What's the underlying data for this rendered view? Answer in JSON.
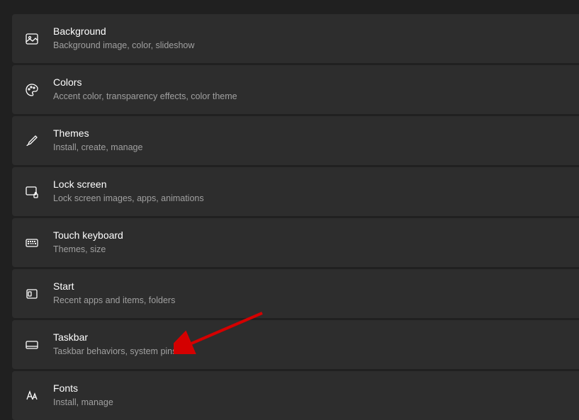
{
  "items": [
    {
      "title": "Background",
      "subtitle": "Background image, color, slideshow"
    },
    {
      "title": "Colors",
      "subtitle": "Accent color, transparency effects, color theme"
    },
    {
      "title": "Themes",
      "subtitle": "Install, create, manage"
    },
    {
      "title": "Lock screen",
      "subtitle": "Lock screen images, apps, animations"
    },
    {
      "title": "Touch keyboard",
      "subtitle": "Themes, size"
    },
    {
      "title": "Start",
      "subtitle": "Recent apps and items, folders"
    },
    {
      "title": "Taskbar",
      "subtitle": "Taskbar behaviors, system pins"
    },
    {
      "title": "Fonts",
      "subtitle": "Install, manage"
    }
  ]
}
